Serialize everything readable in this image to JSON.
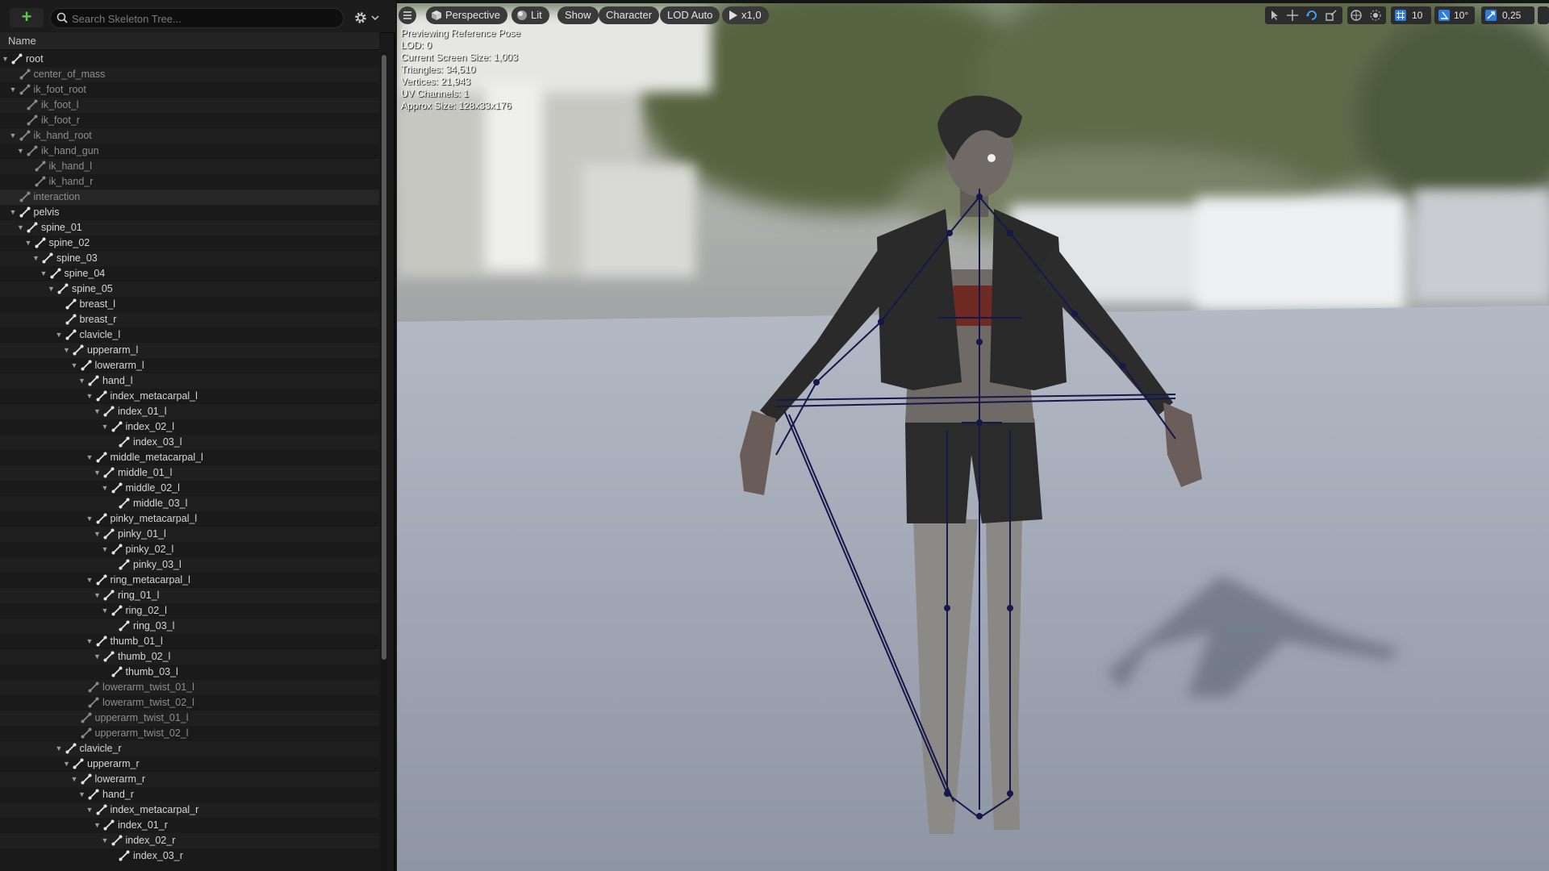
{
  "left_panel": {
    "search_placeholder": "Search Skeleton Tree...",
    "column_header": "Name",
    "bones": [
      {
        "label": "root",
        "depth": 0,
        "expanded": true,
        "dim": false
      },
      {
        "label": "center_of_mass",
        "depth": 1,
        "expanded": null,
        "dim": true
      },
      {
        "label": "ik_foot_root",
        "depth": 1,
        "expanded": true,
        "dim": true
      },
      {
        "label": "ik_foot_l",
        "depth": 2,
        "expanded": null,
        "dim": true
      },
      {
        "label": "ik_foot_r",
        "depth": 2,
        "expanded": null,
        "dim": true
      },
      {
        "label": "ik_hand_root",
        "depth": 1,
        "expanded": true,
        "dim": true
      },
      {
        "label": "ik_hand_gun",
        "depth": 2,
        "expanded": true,
        "dim": true
      },
      {
        "label": "ik_hand_l",
        "depth": 3,
        "expanded": null,
        "dim": true
      },
      {
        "label": "ik_hand_r",
        "depth": 3,
        "expanded": null,
        "dim": true
      },
      {
        "label": "interaction",
        "depth": 1,
        "expanded": null,
        "dim": true,
        "highlight": true
      },
      {
        "label": "pelvis",
        "depth": 1,
        "expanded": true,
        "dim": false
      },
      {
        "label": "spine_01",
        "depth": 2,
        "expanded": true,
        "dim": false
      },
      {
        "label": "spine_02",
        "depth": 3,
        "expanded": true,
        "dim": false
      },
      {
        "label": "spine_03",
        "depth": 4,
        "expanded": true,
        "dim": false
      },
      {
        "label": "spine_04",
        "depth": 5,
        "expanded": true,
        "dim": false
      },
      {
        "label": "spine_05",
        "depth": 6,
        "expanded": true,
        "dim": false
      },
      {
        "label": "breast_l",
        "depth": 7,
        "expanded": null,
        "dim": false
      },
      {
        "label": "breast_r",
        "depth": 7,
        "expanded": null,
        "dim": false
      },
      {
        "label": "clavicle_l",
        "depth": 7,
        "expanded": true,
        "dim": false
      },
      {
        "label": "upperarm_l",
        "depth": 8,
        "expanded": true,
        "dim": false
      },
      {
        "label": "lowerarm_l",
        "depth": 9,
        "expanded": true,
        "dim": false
      },
      {
        "label": "hand_l",
        "depth": 10,
        "expanded": true,
        "dim": false
      },
      {
        "label": "index_metacarpal_l",
        "depth": 11,
        "expanded": true,
        "dim": false
      },
      {
        "label": "index_01_l",
        "depth": 12,
        "expanded": true,
        "dim": false
      },
      {
        "label": "index_02_l",
        "depth": 13,
        "expanded": true,
        "dim": false
      },
      {
        "label": "index_03_l",
        "depth": 14,
        "expanded": null,
        "dim": false
      },
      {
        "label": "middle_metacarpal_l",
        "depth": 11,
        "expanded": true,
        "dim": false
      },
      {
        "label": "middle_01_l",
        "depth": 12,
        "expanded": true,
        "dim": false
      },
      {
        "label": "middle_02_l",
        "depth": 13,
        "expanded": true,
        "dim": false
      },
      {
        "label": "middle_03_l",
        "depth": 14,
        "expanded": null,
        "dim": false
      },
      {
        "label": "pinky_metacarpal_l",
        "depth": 11,
        "expanded": true,
        "dim": false
      },
      {
        "label": "pinky_01_l",
        "depth": 12,
        "expanded": true,
        "dim": false
      },
      {
        "label": "pinky_02_l",
        "depth": 13,
        "expanded": true,
        "dim": false
      },
      {
        "label": "pinky_03_l",
        "depth": 14,
        "expanded": null,
        "dim": false
      },
      {
        "label": "ring_metacarpal_l",
        "depth": 11,
        "expanded": true,
        "dim": false
      },
      {
        "label": "ring_01_l",
        "depth": 12,
        "expanded": true,
        "dim": false
      },
      {
        "label": "ring_02_l",
        "depth": 13,
        "expanded": true,
        "dim": false
      },
      {
        "label": "ring_03_l",
        "depth": 14,
        "expanded": null,
        "dim": false
      },
      {
        "label": "thumb_01_l",
        "depth": 11,
        "expanded": true,
        "dim": false
      },
      {
        "label": "thumb_02_l",
        "depth": 12,
        "expanded": true,
        "dim": false
      },
      {
        "label": "thumb_03_l",
        "depth": 13,
        "expanded": null,
        "dim": false
      },
      {
        "label": "lowerarm_twist_01_l",
        "depth": 10,
        "expanded": null,
        "dim": true
      },
      {
        "label": "lowerarm_twist_02_l",
        "depth": 10,
        "expanded": null,
        "dim": true
      },
      {
        "label": "upperarm_twist_01_l",
        "depth": 9,
        "expanded": null,
        "dim": true
      },
      {
        "label": "upperarm_twist_02_l",
        "depth": 9,
        "expanded": null,
        "dim": true
      },
      {
        "label": "clavicle_r",
        "depth": 7,
        "expanded": true,
        "dim": false
      },
      {
        "label": "upperarm_r",
        "depth": 8,
        "expanded": true,
        "dim": false
      },
      {
        "label": "lowerarm_r",
        "depth": 9,
        "expanded": true,
        "dim": false
      },
      {
        "label": "hand_r",
        "depth": 10,
        "expanded": true,
        "dim": false
      },
      {
        "label": "index_metacarpal_r",
        "depth": 11,
        "expanded": true,
        "dim": false
      },
      {
        "label": "index_01_r",
        "depth": 12,
        "expanded": true,
        "dim": false
      },
      {
        "label": "index_02_r",
        "depth": 13,
        "expanded": true,
        "dim": false
      },
      {
        "label": "index_03_r",
        "depth": 14,
        "expanded": null,
        "dim": false
      }
    ]
  },
  "viewport": {
    "toolbar": {
      "perspective": "Perspective",
      "lit": "Lit",
      "show": "Show",
      "character": "Character",
      "lod": "LOD Auto",
      "play_speed": "x1,0"
    },
    "stats": [
      "Previewing Reference Pose",
      "LOD: 0",
      "Current Screen Size: 1,003",
      "Triangles: 34,510",
      "Vertices: 21,943",
      "UV Channels: 1",
      "Approx Size: 128x33x176"
    ],
    "right_tools": {
      "grid_snap": "10",
      "rotation_snap": "10°",
      "scale_snap": "0,25"
    }
  },
  "colors": {
    "panel_bg": "#1a1a1a",
    "accent_blue": "#2f7de1",
    "add_green": "#5fc84f",
    "skeleton": "#16174a"
  }
}
